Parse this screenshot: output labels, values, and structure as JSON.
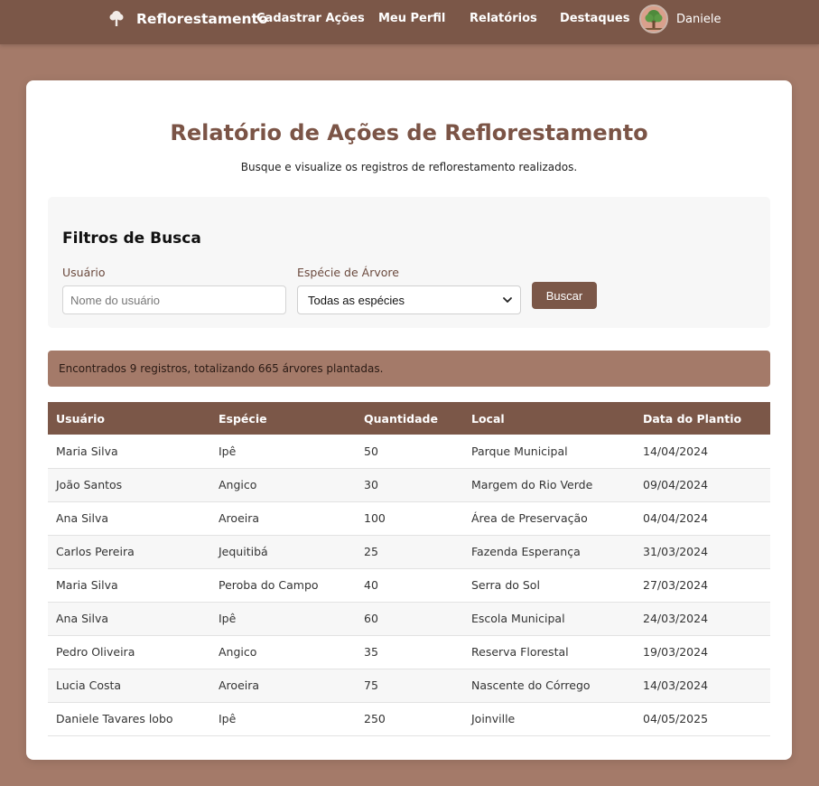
{
  "nav": {
    "brand": "Reflorestamento",
    "links": [
      "Cadastrar Ações",
      "Meu Perfil",
      "Relatórios",
      "Destaques"
    ],
    "user_name": "Daniele"
  },
  "header": {
    "title": "Relatório de Ações de Reflorestamento",
    "subtitle": "Busque e visualize os registros de reflorestamento realizados."
  },
  "filters": {
    "title": "Filtros de Busca",
    "user_label": "Usuário",
    "user_placeholder": "Nome do usuário",
    "user_value": "",
    "species_label": "Espécie de Árvore",
    "species_selected": "Todas as espécies",
    "search_label": "Buscar"
  },
  "summary": "Encontrados 9 registros, totalizando 665 árvores plantadas.",
  "table": {
    "headers": [
      "Usuário",
      "Espécie",
      "Quantidade",
      "Local",
      "Data do Plantio"
    ],
    "rows": [
      [
        "Maria Silva",
        "Ipê",
        "50",
        "Parque Municipal",
        "14/04/2024"
      ],
      [
        "João Santos",
        "Angico",
        "30",
        "Margem do Rio Verde",
        "09/04/2024"
      ],
      [
        "Ana Silva",
        "Aroeira",
        "100",
        "Área de Preservação",
        "04/04/2024"
      ],
      [
        "Carlos Pereira",
        "Jequitibá",
        "25",
        "Fazenda Esperança",
        "31/03/2024"
      ],
      [
        "Maria Silva",
        "Peroba do Campo",
        "40",
        "Serra do Sol",
        "27/03/2024"
      ],
      [
        "Ana Silva",
        "Ipê",
        "60",
        "Escola Municipal",
        "24/03/2024"
      ],
      [
        "Pedro Oliveira",
        "Angico",
        "35",
        "Reserva Florestal",
        "19/03/2024"
      ],
      [
        "Lucia Costa",
        "Aroeira",
        "75",
        "Nascente do Córrego",
        "14/03/2024"
      ],
      [
        "Daniele Tavares lobo",
        "Ipê",
        "250",
        "Joinville",
        "04/05/2025"
      ]
    ]
  },
  "icons": {
    "brand": "tree-icon",
    "avatar": "tree-avatar-icon",
    "select": "chevron-down-icon"
  },
  "colors": {
    "page_background": "#a47a69",
    "navbar": "#7b5748",
    "title": "#7b5446",
    "accent": "#7b5748"
  }
}
